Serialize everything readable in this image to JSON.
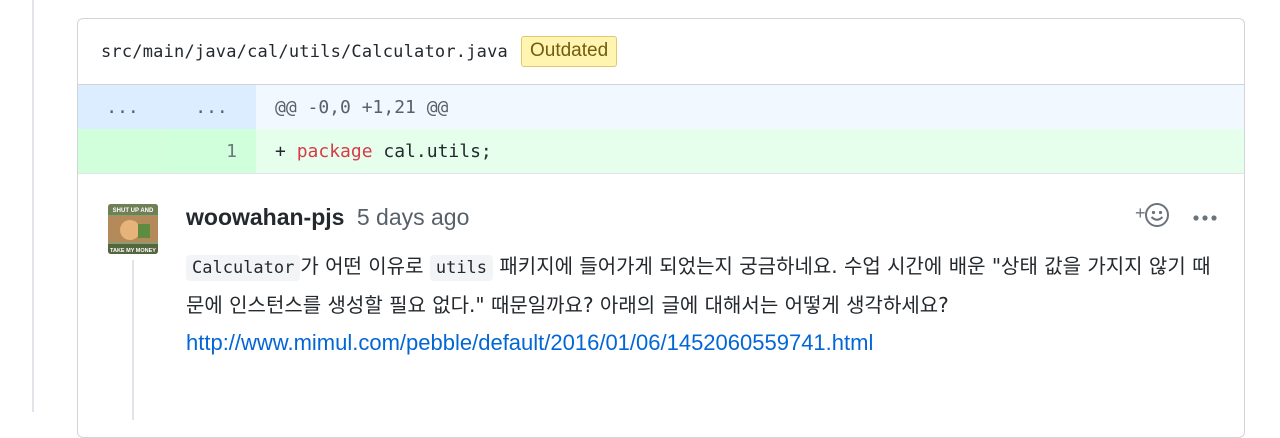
{
  "file": {
    "path": "src/main/java/cal/utils/Calculator.java",
    "badge": "Outdated"
  },
  "diff": {
    "hunk": {
      "old_num": "...",
      "new_num": "...",
      "text": "@@ -0,0 +1,21 @@"
    },
    "lines": [
      {
        "old_num": "",
        "new_num": "1",
        "prefix": "+ ",
        "keyword": "package",
        "rest": " cal.utils;"
      }
    ]
  },
  "comment": {
    "author": "woowahan-pjs",
    "time": "5 days ago",
    "avatar_top_text": "SHUT UP AND",
    "avatar_bottom_text": "TAKE MY MONEY",
    "body": {
      "code1": "Calculator",
      "t1": "가 어떤 이유로 ",
      "code2": "utils",
      "t2": " 패키지에 들어가게 되었는지 궁금하네요. 수업 시간에 배운 \"상태 값을 가지지 않기 때문에 인스턴스를 생성할 필요 없다.\" 때문일까요? 아래의 글에 대해서는 어떻게 생각하세요?",
      "link": "http://www.mimul.com/pebble/default/2016/01/06/1452060559741.html"
    },
    "actions": {
      "add_reaction_icon": "smiley-plus-icon",
      "more_icon": "kebab-horizontal-icon"
    }
  }
}
